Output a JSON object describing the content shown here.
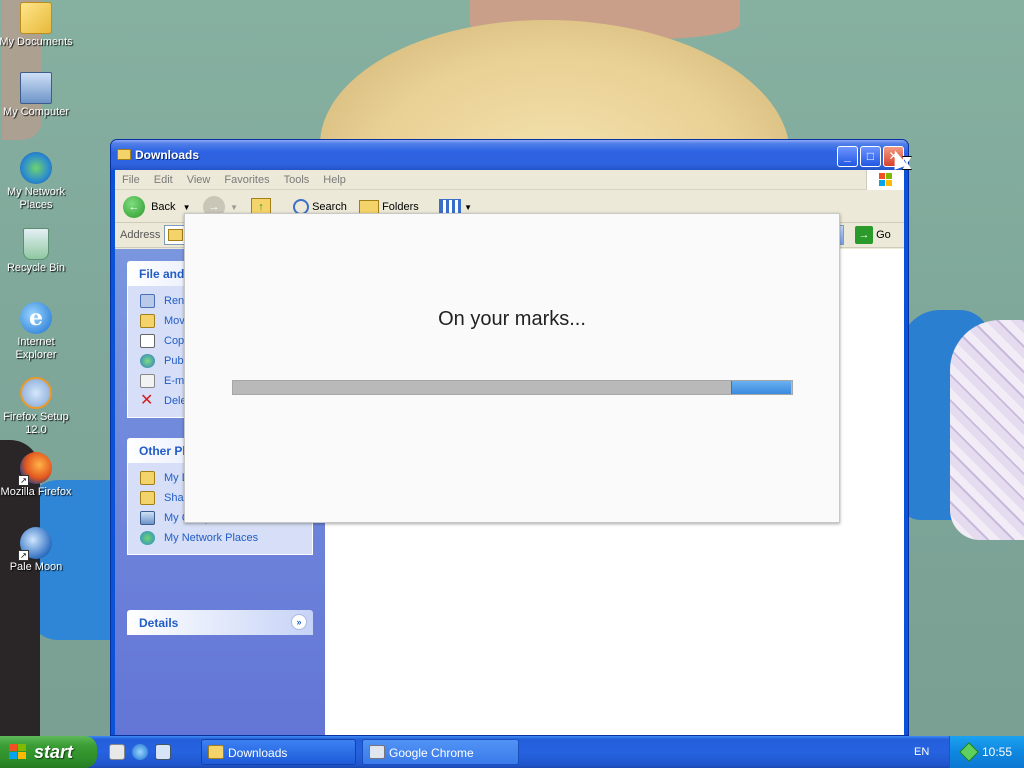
{
  "desktop": {
    "icons": [
      {
        "label": "My Documents",
        "icon": "my-documents-icon"
      },
      {
        "label": "My Computer",
        "icon": "my-computer-icon"
      },
      {
        "label": "My Network Places",
        "icon": "network-places-icon"
      },
      {
        "label": "Recycle Bin",
        "icon": "recycle-bin-icon"
      },
      {
        "label": "Internet Explorer",
        "icon": "internet-explorer-icon"
      },
      {
        "label": "Firefox Setup 12.0",
        "icon": "firefox-setup-icon"
      },
      {
        "label": "Mozilla Firefox",
        "icon": "firefox-icon"
      },
      {
        "label": "Pale Moon",
        "icon": "pale-moon-icon"
      }
    ]
  },
  "window": {
    "title": "Downloads",
    "menu": [
      "File",
      "Edit",
      "View",
      "Favorites",
      "Tools",
      "Help"
    ],
    "toolbar": {
      "back": "Back",
      "search": "Search",
      "folders": "Folders"
    },
    "address": {
      "label": "Address",
      "go": "Go"
    },
    "sidebar": {
      "file_tasks": {
        "title": "File and",
        "items": [
          "Rena",
          "Move",
          "Copy",
          "Publi",
          "E-ma",
          "Dele"
        ]
      },
      "other_places": {
        "title": "Other Pl",
        "items": [
          "My D",
          "Shar",
          "My Computer",
          "My Network Places"
        ]
      },
      "details": {
        "title": "Details"
      }
    }
  },
  "installer": {
    "message": "On your marks...",
    "progress_indeterminate": true
  },
  "taskbar": {
    "start_label": "start",
    "tasks": [
      "Downloads",
      "Google Chrome Installer"
    ],
    "language": "EN",
    "clock": "10:55"
  },
  "colors": {
    "xp_blue": "#245edb",
    "start_green": "#3b9d35",
    "progress_blue": "#3a8ae0",
    "task_link_blue": "#215dc6"
  }
}
